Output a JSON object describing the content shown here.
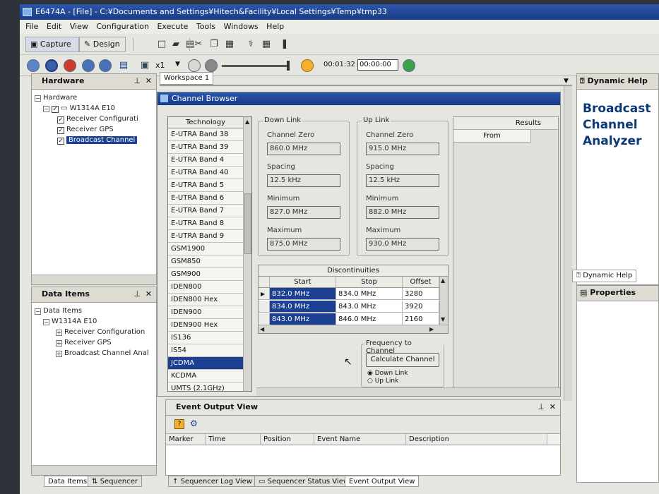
{
  "window": {
    "title": "E6474A - [File] - C:¥Documents and Settings¥Hitech&Facility¥Local Settings¥Temp¥tmp33"
  },
  "menu": [
    "File",
    "Edit",
    "View",
    "Configuration",
    "Execute",
    "Tools",
    "Windows",
    "Help"
  ],
  "toolbar": {
    "capture_label": "Capture",
    "design_label": "Design",
    "speed_label": "x1",
    "elapsed": "00:01:32",
    "time_input": "00:00:00"
  },
  "hardware": {
    "title": "Hardware",
    "root": "Hardware",
    "device": "W1314A E10",
    "items": [
      "Receiver Configurati",
      "Receiver GPS",
      "Broadcast Channel"
    ]
  },
  "data_items": {
    "title": "Data Items",
    "root": "Data Items",
    "device": "W1314A E10",
    "items": [
      "Receiver Configuration",
      "Receiver GPS",
      "Broadcast Channel Anal"
    ]
  },
  "workspace": {
    "tab": "Workspace 1"
  },
  "channel_browser": {
    "title": "Channel Browser",
    "technology_header": "Technology",
    "technologies": [
      "E-UTRA Band 38",
      "E-UTRA Band 39",
      "E-UTRA Band 4",
      "E-UTRA Band 40",
      "E-UTRA Band 5",
      "E-UTRA Band 6",
      "E-UTRA Band 7",
      "E-UTRA Band 8",
      "E-UTRA Band 9",
      "GSM1900",
      "GSM850",
      "GSM900",
      "IDEN800",
      "IDEN800 Hex",
      "IDEN900",
      "IDEN900 Hex",
      "IS136",
      "IS54",
      "JCDMA",
      "KCDMA",
      "UMTS (2.1GHz)"
    ],
    "selected_technology": "JCDMA",
    "down_link": {
      "title": "Down Link",
      "channel_zero_label": "Channel Zero",
      "channel_zero": "860.0 MHz",
      "spacing_label": "Spacing",
      "spacing": "12.5 kHz",
      "minimum_label": "Minimum",
      "minimum": "827.0 MHz",
      "maximum_label": "Maximum",
      "maximum": "875.0 MHz"
    },
    "up_link": {
      "title": "Up Link",
      "channel_zero_label": "Channel Zero",
      "channel_zero": "915.0 MHz",
      "spacing_label": "Spacing",
      "spacing": "12.5 kHz",
      "minimum_label": "Minimum",
      "minimum": "882.0 MHz",
      "maximum_label": "Maximum",
      "maximum": "930.0 MHz"
    },
    "discontinuities": {
      "title": "Discontinuities",
      "headers": [
        "Start",
        "Stop",
        "Offset"
      ],
      "rows": [
        {
          "start": "832.0 MHz",
          "stop": "834.0 MHz",
          "offset": "3280"
        },
        {
          "start": "834.0 MHz",
          "stop": "843.0 MHz",
          "offset": "3920"
        },
        {
          "start": "843.0 MHz",
          "stop": "846.0 MHz",
          "offset": "2160"
        }
      ]
    },
    "results": {
      "title": "Results",
      "from_header": "From"
    },
    "frequency_to_channel": {
      "title": "Frequency to Channel",
      "button": "Calculate Channel",
      "option_down": "Down Link",
      "option_up": "Up Link",
      "selected": "Down Link"
    }
  },
  "dynamic_help": {
    "title": "Dynamic Help",
    "content": "Broadcast Channel Analyzer",
    "tab_label": "Dynamic Help"
  },
  "properties": {
    "title": "Properties"
  },
  "event_output": {
    "title": "Event Output View",
    "columns": [
      "Marker",
      "Time",
      "Position",
      "Event Name",
      "Description"
    ]
  },
  "bottom_tabs": {
    "left": [
      "Data Items",
      "Sequencer"
    ],
    "center": [
      "Sequencer Log View",
      "Sequencer Status View",
      "Event Output View"
    ]
  }
}
